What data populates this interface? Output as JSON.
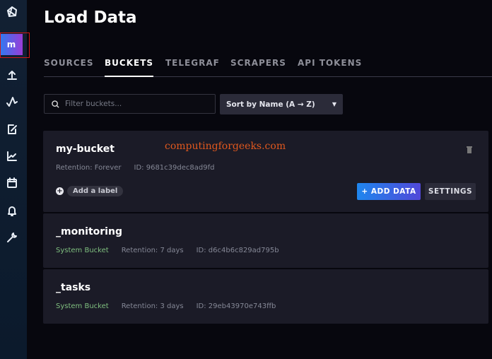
{
  "sidebar": {
    "org_initial": "m",
    "items": [
      "logo",
      "organization",
      "load-data",
      "data-explorer",
      "notebooks",
      "dashboards",
      "tasks",
      "alerts",
      "settings"
    ]
  },
  "header": {
    "title": "Load Data"
  },
  "tabs": [
    {
      "label": "SOURCES"
    },
    {
      "label": "BUCKETS",
      "active": true
    },
    {
      "label": "TELEGRAF"
    },
    {
      "label": "SCRAPERS"
    },
    {
      "label": "API TOKENS"
    }
  ],
  "filter": {
    "placeholder": "Filter buckets...",
    "value": ""
  },
  "sort": {
    "selected": "Sort by Name (A → Z)"
  },
  "watermark": "computingforgeeks.com",
  "buckets": [
    {
      "name": "my-bucket",
      "retention": "Retention: Forever",
      "id": "ID: 9681c39dec8ad9fd",
      "add_label": "Add a label",
      "add_data": "+ ADD DATA",
      "settings": "SETTINGS"
    },
    {
      "name": "_monitoring",
      "type": "System Bucket",
      "retention": "Retention: 7 days",
      "id": "ID: d6c4b6c829ad795b"
    },
    {
      "name": "_tasks",
      "type": "System Bucket",
      "retention": "Retention: 3 days",
      "id": "ID: 29eb43970e743ffb"
    }
  ],
  "colors": {
    "accent": "#1f86ee",
    "system": "#7fbf7f",
    "highlight": "#d01818"
  }
}
